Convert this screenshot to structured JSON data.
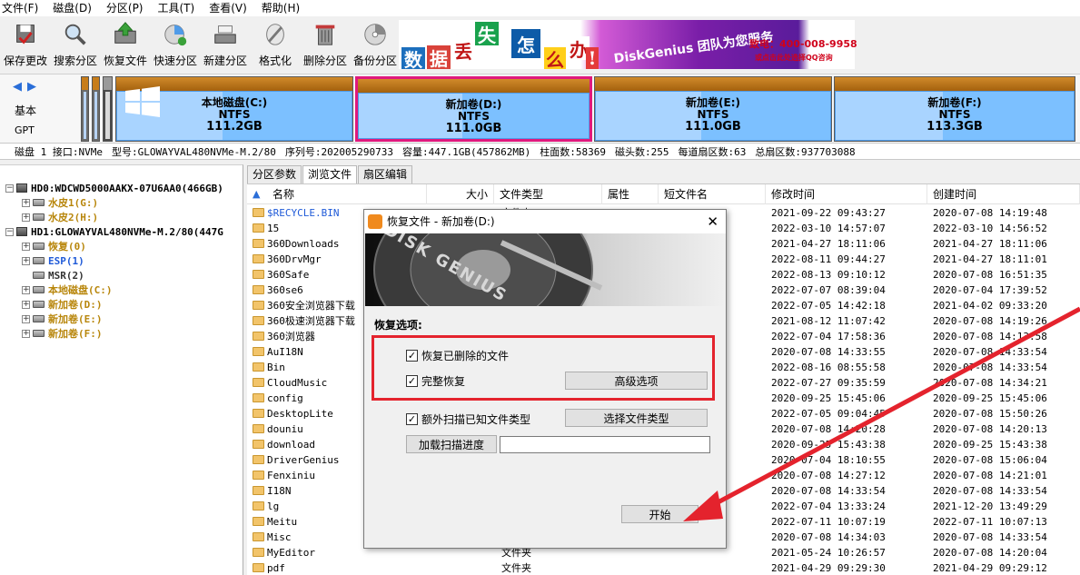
{
  "menu": [
    "文件(F)",
    "磁盘(D)",
    "分区(P)",
    "工具(T)",
    "查看(V)",
    "帮助(H)"
  ],
  "toolbar": [
    {
      "label": "保存更改",
      "icon": "save-icon"
    },
    {
      "label": "搜索分区",
      "icon": "magnifier-icon"
    },
    {
      "label": "恢复文件",
      "icon": "restore-box-icon"
    },
    {
      "label": "快速分区",
      "icon": "quick-partition-icon"
    },
    {
      "label": "新建分区",
      "icon": "new-partition-icon"
    },
    {
      "label": "格式化",
      "icon": "format-icon"
    },
    {
      "label": "删除分区",
      "icon": "trash-icon"
    },
    {
      "label": "备份分区",
      "icon": "backup-disc-icon"
    }
  ],
  "banner": {
    "chars": [
      "数",
      "据",
      "丢",
      "失",
      "怎",
      "么",
      "办",
      "!"
    ],
    "slogan": "DiskGenius 团队为您服务",
    "phone": "致电：400-008-9958",
    "qq": "或点击此处选择QQ咨询"
  },
  "diskmap": {
    "type1": "基本",
    "type2": "GPT",
    "partitions": [
      {
        "name": "本地磁盘(C:)",
        "fs": "NTFS",
        "size": "111.2GB",
        "selected": false
      },
      {
        "name": "新加卷(D:)",
        "fs": "NTFS",
        "size": "111.0GB",
        "selected": true
      },
      {
        "name": "新加卷(E:)",
        "fs": "NTFS",
        "size": "111.0GB",
        "selected": false
      },
      {
        "name": "新加卷(F:)",
        "fs": "NTFS",
        "size": "113.3GB",
        "selected": false
      }
    ]
  },
  "disk_info": [
    "磁盘 1 接口:NVMe",
    "型号:GLOWAYVAL480NVMe-M.2/80",
    "序列号:202005290733",
    "容量:447.1GB(457862MB)",
    "柱面数:58369",
    "磁头数:255",
    "每道扇区数:63",
    "总扇区数:937703088"
  ],
  "tree": [
    {
      "text": "HD0:WDCWD5000AAKX-07U6AA0(466GB)",
      "level": 0,
      "kind": "disk",
      "expander": "−",
      "color": "#000000"
    },
    {
      "text": "水皮1(G:)",
      "level": 1,
      "kind": "part",
      "expander": "+",
      "color": "#b8860b"
    },
    {
      "text": "水皮2(H:)",
      "level": 1,
      "kind": "part",
      "expander": "+",
      "color": "#b8860b"
    },
    {
      "text": "HD1:GLOWAYVAL480NVMe-M.2/80(447G",
      "level": 0,
      "kind": "disk",
      "expander": "−",
      "color": "#000000"
    },
    {
      "text": "恢复(0)",
      "level": 1,
      "kind": "part",
      "expander": "+",
      "color": "#b8860b"
    },
    {
      "text": "ESP(1)",
      "level": 1,
      "kind": "part",
      "expander": "+",
      "color": "#1f5ad8"
    },
    {
      "text": "MSR(2)",
      "level": 1,
      "kind": "part",
      "expander": "",
      "color": "#333333"
    },
    {
      "text": "本地磁盘(C:)",
      "level": 1,
      "kind": "part",
      "expander": "+",
      "color": "#b8860b"
    },
    {
      "text": "新加卷(D:)",
      "level": 1,
      "kind": "part",
      "expander": "+",
      "color": "#b8860b"
    },
    {
      "text": "新加卷(E:)",
      "level": 1,
      "kind": "part",
      "expander": "+",
      "color": "#b8860b"
    },
    {
      "text": "新加卷(F:)",
      "level": 1,
      "kind": "part",
      "expander": "+",
      "color": "#b8860b"
    }
  ],
  "tabs": [
    {
      "label": "分区参数",
      "active": false
    },
    {
      "label": "浏览文件",
      "active": true
    },
    {
      "label": "扇区编辑",
      "active": false
    }
  ],
  "columns": {
    "name": "名称",
    "size": "大小",
    "type": "文件类型",
    "attr": "属性",
    "short": "短文件名",
    "mtime": "修改时间",
    "ctime": "创建时间"
  },
  "files": [
    {
      "name": "$RECYCLE.BIN",
      "type": "文件夹",
      "mtime": "2021-09-22 09:43:27",
      "ctime": "2020-07-08 14:19:48",
      "blue": true
    },
    {
      "name": "15",
      "type": "",
      "mtime": "2022-03-10 14:57:07",
      "ctime": "2022-03-10 14:56:52"
    },
    {
      "name": "360Downloads",
      "type": "",
      "mtime": "2021-04-27 18:11:06",
      "ctime": "2021-04-27 18:11:06"
    },
    {
      "name": "360DrvMgr",
      "type": "",
      "mtime": "2022-08-11 09:44:27",
      "ctime": "2021-04-27 18:11:01"
    },
    {
      "name": "360Safe",
      "type": "",
      "mtime": "2022-08-13 09:10:12",
      "ctime": "2020-07-08 16:51:35"
    },
    {
      "name": "360se6",
      "type": "",
      "mtime": "2022-07-07 08:39:04",
      "ctime": "2020-07-04 17:39:52"
    },
    {
      "name": "360安全浏览器下载",
      "type": "",
      "mtime": "2022-07-05 14:42:18",
      "ctime": "2021-04-02 09:33:20"
    },
    {
      "name": "360极速浏览器下载",
      "type": "",
      "mtime": "2021-08-12 11:07:42",
      "ctime": "2020-07-08 14:19:26"
    },
    {
      "name": "360浏览器",
      "type": "",
      "mtime": "2022-07-04 17:58:36",
      "ctime": "2020-07-08 14:13:58"
    },
    {
      "name": "AuI18N",
      "type": "",
      "mtime": "2020-07-08 14:33:55",
      "ctime": "2020-07-08 14:33:54"
    },
    {
      "name": "Bin",
      "type": "",
      "mtime": "2022-08-16 08:55:58",
      "ctime": "2020-07-08 14:33:54"
    },
    {
      "name": "CloudMusic",
      "type": "",
      "mtime": "2022-07-27 09:35:59",
      "ctime": "2020-07-08 14:34:21"
    },
    {
      "name": "config",
      "type": "",
      "mtime": "2020-09-25 15:45:06",
      "ctime": "2020-09-25 15:45:06"
    },
    {
      "name": "DesktopLite",
      "type": "",
      "mtime": "2022-07-05 09:04:45",
      "ctime": "2020-07-08 15:50:26"
    },
    {
      "name": "douniu",
      "type": "",
      "mtime": "2020-07-08 14:20:28",
      "ctime": "2020-07-08 14:20:13"
    },
    {
      "name": "download",
      "type": "",
      "mtime": "2020-09-25 15:43:38",
      "ctime": "2020-09-25 15:43:38"
    },
    {
      "name": "DriverGenius",
      "type": "",
      "mtime": "2020-07-04 18:10:55",
      "ctime": "2020-07-08 15:06:04"
    },
    {
      "name": "Fenxiniu",
      "type": "",
      "mtime": "2020-07-08 14:27:12",
      "ctime": "2020-07-08 14:21:01"
    },
    {
      "name": "I18N",
      "type": "",
      "mtime": "2020-07-08 14:33:54",
      "ctime": "2020-07-08 14:33:54"
    },
    {
      "name": "lg",
      "type": "",
      "mtime": "2022-07-04 13:33:24",
      "ctime": "2021-12-20 13:49:29"
    },
    {
      "name": "Meitu",
      "type": "",
      "mtime": "2022-07-11 10:07:19",
      "ctime": "2022-07-11 10:07:13"
    },
    {
      "name": "Misc",
      "type": "",
      "mtime": "2020-07-08 14:34:03",
      "ctime": "2020-07-08 14:33:54"
    },
    {
      "name": "MyEditor",
      "type": "文件夹",
      "mtime": "2021-05-24 10:26:57",
      "ctime": "2020-07-08 14:20:04"
    },
    {
      "name": "pdf",
      "type": "文件夹",
      "mtime": "2021-04-29 09:29:30",
      "ctime": "2021-04-29 09:29:12"
    }
  ],
  "dialog": {
    "title": "恢复文件 - 新加卷(D:)",
    "image_text": "DISK GENIUS",
    "section": "恢复选项:",
    "opt_deleted": "恢复已删除的文件",
    "opt_full": "完整恢复",
    "btn_advanced": "高级选项",
    "opt_extra": "额外扫描已知文件类型",
    "btn_types": "选择文件类型",
    "btn_load": "加载扫描进度",
    "progress_value": "",
    "btn_start": "开始",
    "close": "✕"
  },
  "colors": {
    "highlight_border": "#e4232d",
    "arrow": "#e4232d",
    "selected_partition": "#e0197d"
  }
}
